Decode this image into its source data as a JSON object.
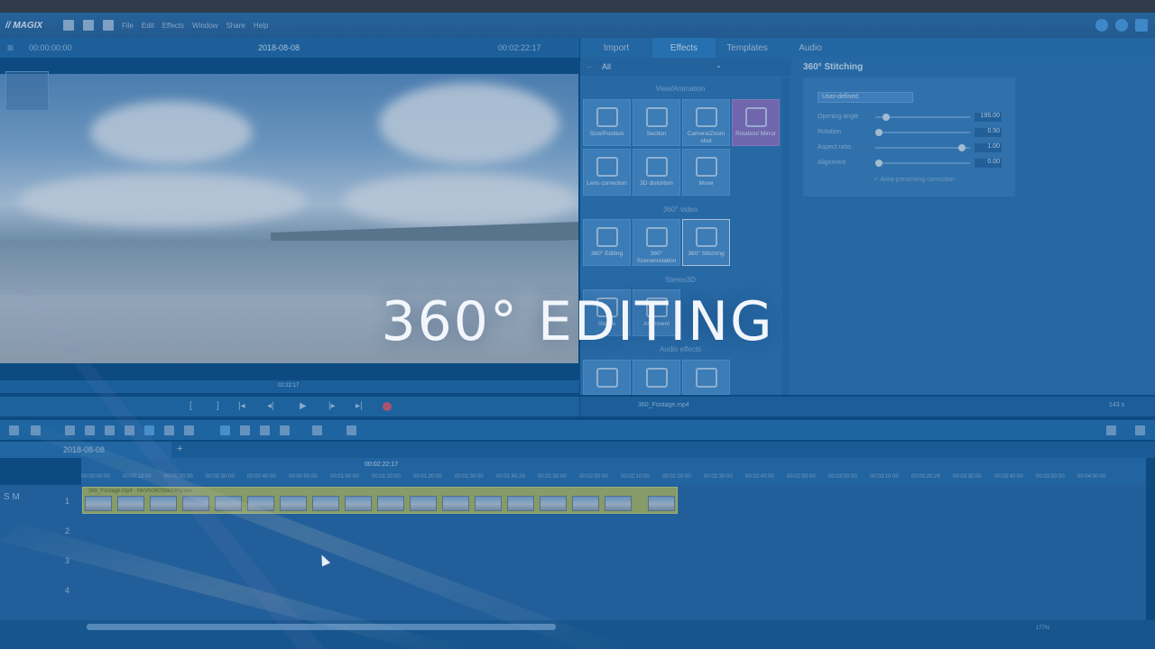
{
  "app": {
    "logo": "// MAGIX",
    "menu": [
      "File",
      "Edit",
      "Effects",
      "Window",
      "Share",
      "Help"
    ]
  },
  "preview": {
    "timecode_start": "00:00:00:00",
    "date": "2018-08-08",
    "timecode_end": "00:02:22:17",
    "scrub_time": "02:22:17",
    "transport": [
      "[",
      "]",
      "|◂",
      "◂|",
      "▶",
      "|▸",
      "▸|"
    ]
  },
  "panel_tabs": [
    "Import",
    "Effects",
    "Templates",
    "Audio"
  ],
  "effects": {
    "filter": "All",
    "sections": {
      "view_animation": "View/Animation",
      "video360": "360° video",
      "stereo3d": "Stereo3D",
      "audio_effects": "Audio effects"
    },
    "tiles_view": [
      "Size/Position",
      "Section",
      "Camera/Zoom shot",
      "Rotation/ Mirror",
      "Lens correction",
      "3D distortion",
      "Move"
    ],
    "tiles_360": [
      "360° Editing",
      "360° Szenenrotation",
      "360° Stitching"
    ],
    "tiles_stereo": [
      "Stereo",
      "Alignment"
    ]
  },
  "properties": {
    "title": "360° Stitching",
    "mode": "User-defined",
    "params": [
      {
        "label": "Opening angle",
        "value": "195.00",
        "level": 0.12
      },
      {
        "label": "Rotation",
        "value": "0.50",
        "level": 0.04
      },
      {
        "label": "Aspect ratio",
        "value": "1.00",
        "level": 0.95
      },
      {
        "label": "Alignment",
        "value": "0.00",
        "level": 0.04
      }
    ],
    "checkbox": "Area-preserving correction"
  },
  "media_bar": {
    "file": "360_Footage.mp4",
    "duration": "143 s"
  },
  "timeline": {
    "tab": "2018-08-08",
    "playhead": "00:02:22:17",
    "ruler": [
      "00:00:00:00",
      "00:00:10:00",
      "00:00:20:00",
      "00:00:30:00",
      "00:00:40:00",
      "00:00:50:00",
      "00:01:00:00",
      "00:01:10:00",
      "00:01:20:00",
      "00:01:30:00",
      "00:01:40:29",
      "00:01:50:00",
      "00:02:00:00",
      "00:02:10:00",
      "00:02:20:00",
      "00:02:30:00",
      "00:02:40:00",
      "00:02:50:00",
      "00:03:00:00",
      "00:03:10:00",
      "00:03:20:29",
      "00:03:30:00",
      "00:03:40:00",
      "00:03:50:00",
      "00:04:00:00"
    ],
    "tracks": [
      "1",
      "2",
      "3",
      "4"
    ],
    "track_controls": "S M",
    "clip_label": "360_Footage.mp4 · MxVfx360Stitching.vsx",
    "zoom": "177%"
  },
  "overlay": {
    "title": "360° EDITING"
  },
  "colors": {
    "accent": "#2f7fc0",
    "tile_purple": "#8d72bf",
    "clip": "#a9b764",
    "record": "#d95a6c"
  }
}
